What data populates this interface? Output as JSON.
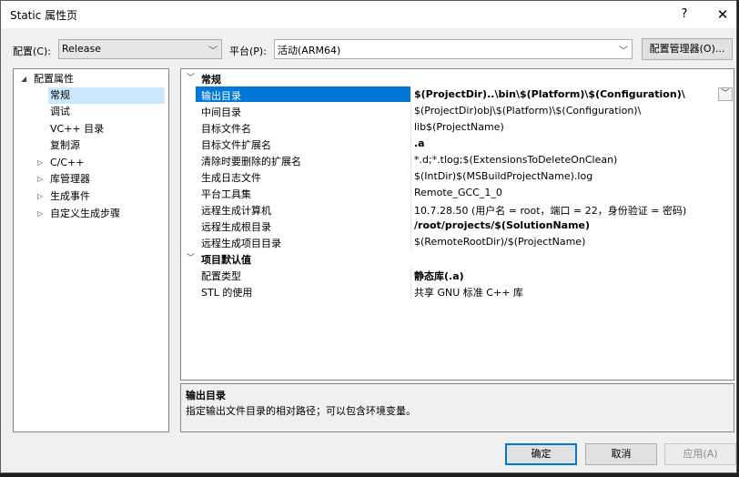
{
  "window": {
    "title": "Static 属性页",
    "help": "?",
    "close": "✕"
  },
  "config_bar": {
    "config_label": "配置(C):",
    "config_value": "Release",
    "platform_label": "平台(P):",
    "platform_value": "活动(ARM64)",
    "manager_button": "配置管理器(O)..."
  },
  "tree": {
    "items": [
      {
        "label": "配置属性",
        "arrow": "◢"
      },
      {
        "label": "常规"
      },
      {
        "label": "调试"
      },
      {
        "label": "VC++ 目录"
      },
      {
        "label": "复制源"
      },
      {
        "label": "C/C++",
        "arrow": "▷"
      },
      {
        "label": "库管理器",
        "arrow": "▷"
      },
      {
        "label": "生成事件",
        "arrow": "▷"
      },
      {
        "label": "自定义生成步骤",
        "arrow": "▷"
      }
    ]
  },
  "grid": {
    "cat1": "常规",
    "cat2": "项目默认值",
    "rows": [
      {
        "k": "输出目录",
        "v": "$(ProjectDir)..\\bin\\$(Platform)\\$(Configuration)\\"
      },
      {
        "k": "中间目录",
        "v": "$(ProjectDir)obj\\$(Platform)\\$(Configuration)\\"
      },
      {
        "k": "目标文件名",
        "v": "lib$(ProjectName)"
      },
      {
        "k": "目标文件扩展名",
        "v": ".a"
      },
      {
        "k": "清除时要删除的扩展名",
        "v": "*.d;*.tlog;$(ExtensionsToDeleteOnClean)"
      },
      {
        "k": "生成日志文件",
        "v": "$(IntDir)$(MSBuildProjectName).log"
      },
      {
        "k": "平台工具集",
        "v": "Remote_GCC_1_0"
      },
      {
        "k": "远程生成计算机",
        "v": "10.7.28.50 (用户名 = root，端口 = 22，身份验证 = 密码)"
      },
      {
        "k": "远程生成根目录",
        "v": "/root/projects/$(SolutionName)"
      },
      {
        "k": "远程生成项目目录",
        "v": "$(RemoteRootDir)/$(ProjectName)"
      }
    ],
    "rows2": [
      {
        "k": "配置类型",
        "v": "静态库(.a)"
      },
      {
        "k": "STL 的使用",
        "v": "共享 GNU 标准 C++ 库"
      }
    ]
  },
  "description": {
    "title": "输出目录",
    "text": "指定输出文件目录的相对路径；可以包含环境变量。"
  },
  "buttons": {
    "ok": "确定",
    "cancel": "取消",
    "apply": "应用(A)"
  },
  "colors": {
    "selection": "#0078d7",
    "tree_selection": "#cce8ff"
  }
}
